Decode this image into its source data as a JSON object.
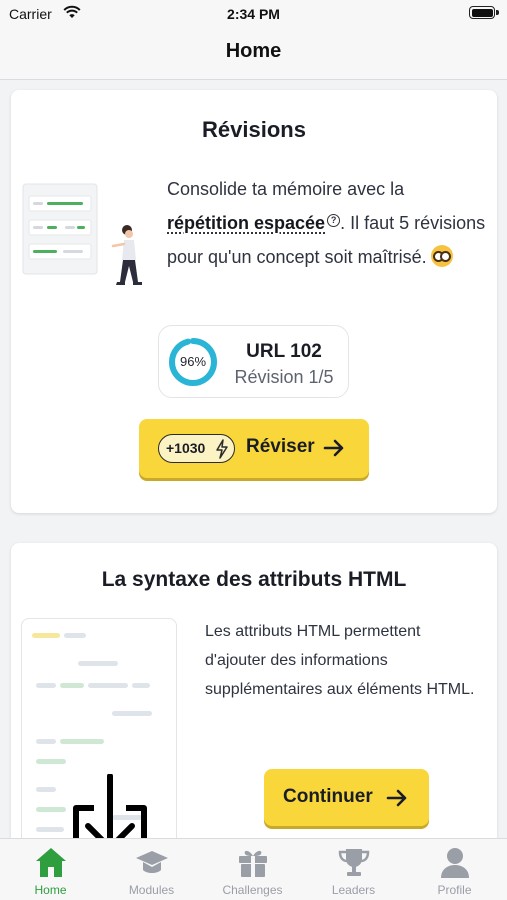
{
  "status_bar": {
    "carrier": "Carrier",
    "time": "2:34 PM"
  },
  "header": {
    "title": "Home"
  },
  "review_card": {
    "title": "Révisions",
    "desc_prefix": "Consolide ta mémoire avec la ",
    "desc_link": "répétition espacée",
    "desc_suffix": ". Il faut 5 révisions pour qu'un concept soit maîtrisé.",
    "progress": {
      "percent_label": "96%",
      "percent": 96,
      "lesson": "URL 102",
      "revision": "Révision 1/5"
    },
    "button": {
      "xp": "+1030",
      "label": "Réviser"
    }
  },
  "lesson_card": {
    "title": "La syntaxe des attributs HTML",
    "description": "Les attributs HTML permettent d'ajouter des informations supplémentaires aux éléments HTML.",
    "button_label": "Continuer"
  },
  "tab_bar": {
    "items": [
      {
        "label": "Home",
        "icon": "home-icon",
        "active": true
      },
      {
        "label": "Modules",
        "icon": "graduation-cap-icon",
        "active": false
      },
      {
        "label": "Challenges",
        "icon": "gift-icon",
        "active": false
      },
      {
        "label": "Leaders",
        "icon": "trophy-icon",
        "active": false
      },
      {
        "label": "Profile",
        "icon": "user-icon",
        "active": false
      }
    ]
  },
  "colors": {
    "accent_yellow": "#f9d73a",
    "ring_blue": "#2ab4d6",
    "active_green": "#2e9e3e",
    "inactive_gray": "#9a9ea6"
  }
}
